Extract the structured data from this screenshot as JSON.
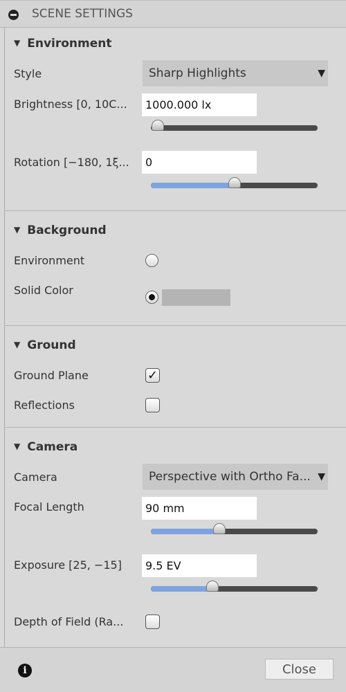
{
  "header": {
    "title": "SCENE SETTINGS"
  },
  "environment": {
    "title": "Environment",
    "style_label": "Style",
    "style_value": "Sharp Highlights",
    "brightness_label": "Brightness [0, 10C...",
    "brightness_value": "1000.000 lx",
    "brightness_slider": 0.04,
    "rotation_label": "Rotation [−180, 1ξ...",
    "rotation_value": "0",
    "rotation_slider": 0.5
  },
  "background": {
    "title": "Background",
    "environment_label": "Environment",
    "environment_selected": false,
    "solid_label": "Solid Color",
    "solid_selected": true,
    "solid_color": "#b4b4b4"
  },
  "ground": {
    "title": "Ground",
    "plane_label": "Ground Plane",
    "plane_checked": true,
    "reflections_label": "Reflections",
    "reflections_checked": false
  },
  "camera": {
    "title": "Camera",
    "camera_label": "Camera",
    "camera_value": "Perspective with Ortho Fa...",
    "focal_label": "Focal Length",
    "focal_value": "90 mm",
    "focal_slider": 0.41,
    "exposure_label": "Exposure [25, −15]",
    "exposure_value": "9.5 EV",
    "exposure_slider": 0.37,
    "dof_label": "Depth of Field (Ra...",
    "dof_checked": false
  },
  "footer": {
    "close_label": "Close"
  },
  "colors": {
    "slider_fill": "#7fa3dd",
    "accent_track": "#4a4a4a"
  }
}
